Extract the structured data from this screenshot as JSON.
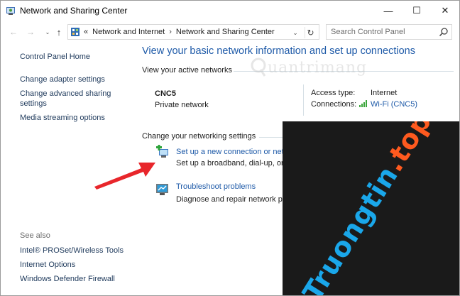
{
  "window": {
    "title": "Network and Sharing Center",
    "controls": {
      "minimize": "—",
      "maximize": "☐",
      "close": "✕"
    }
  },
  "navbar": {
    "back": "←",
    "forward": "→",
    "recent": "⌄",
    "up": "↑",
    "address": {
      "prefix": "«",
      "crumbs": [
        "Network and Internet",
        "Network and Sharing Center"
      ],
      "separator": "›",
      "dropdown": "⌄",
      "refresh": "↻"
    },
    "search": {
      "placeholder": "Search Control Panel"
    }
  },
  "left_pane": {
    "home": "Control Panel Home",
    "links": [
      "Change adapter settings",
      "Change advanced sharing settings",
      "Media streaming options"
    ],
    "see_also_label": "See also",
    "see_also": [
      "Intel® PROSet/Wireless Tools",
      "Internet Options",
      "Windows Defender Firewall"
    ]
  },
  "main": {
    "headline": "View your basic network information and set up connections",
    "active_networks_label": "View your active networks",
    "network": {
      "name": "CNC5",
      "category": "Private network",
      "access_type_label": "Access type:",
      "access_type": "Internet",
      "connections_label": "Connections:",
      "connection": "Wi-Fi (CNC5)"
    },
    "change_settings_label": "Change your networking settings",
    "tasks": [
      {
        "link": "Set up a new connection or netw",
        "desc": "Set up a broadband, dial-up, or V"
      },
      {
        "link": "Troubleshoot problems",
        "desc": "Diagnose and repair network pro"
      }
    ]
  },
  "overlays": {
    "watermark": "uantrimang",
    "promo_part1": "Truongtin",
    "promo_part2": ".top"
  },
  "colors": {
    "link": "#1e5aa8",
    "nav_link": "#1e395b",
    "promo_bg": "#1a1a1a",
    "promo_blue": "#1aa7ea",
    "promo_orange": "#ff5a1f",
    "arrow": "#e8262b"
  }
}
